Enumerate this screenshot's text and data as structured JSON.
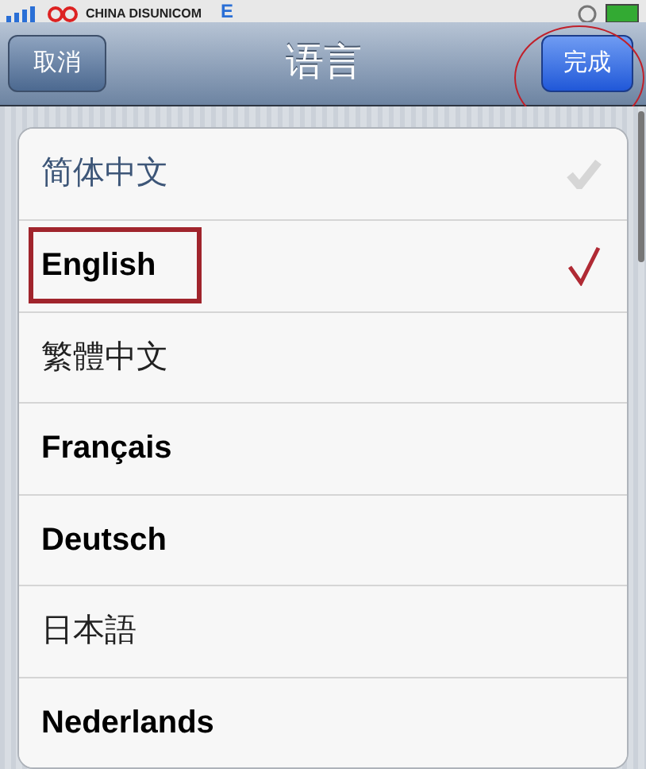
{
  "status_bar": {
    "carrier": "CHINA DISUNICOM",
    "network": "E"
  },
  "nav_bar": {
    "cancel": "取消",
    "title": "语言",
    "done": {
      "label": "完成",
      "circled": true
    }
  },
  "languages": [
    {
      "label": "简体中文",
      "bold": false,
      "selected": false,
      "faint_check": true,
      "boxed": false
    },
    {
      "label": "English",
      "bold": true,
      "selected": true,
      "faint_check": false,
      "boxed": true
    },
    {
      "label": "繁體中文",
      "bold": false,
      "selected": false,
      "faint_check": false,
      "boxed": false
    },
    {
      "label": "Français",
      "bold": true,
      "selected": false,
      "faint_check": false,
      "boxed": false
    },
    {
      "label": "Deutsch",
      "bold": true,
      "selected": false,
      "faint_check": false,
      "boxed": false
    },
    {
      "label": "日本語",
      "bold": false,
      "selected": false,
      "faint_check": false,
      "boxed": false
    },
    {
      "label": "Nederlands",
      "bold": true,
      "selected": false,
      "faint_check": false,
      "boxed": false
    }
  ]
}
